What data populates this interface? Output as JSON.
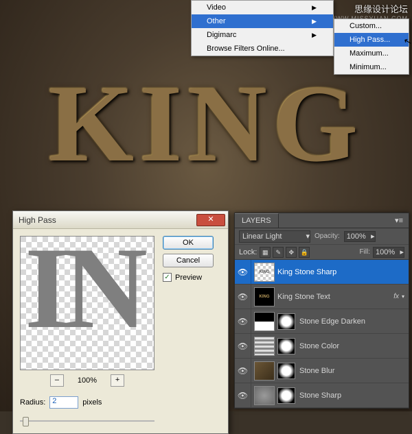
{
  "watermark": {
    "text": "思缘设计论坛",
    "sub": "WWW.MISSYUAN.COM"
  },
  "canvas": {
    "text": "KING"
  },
  "menu1": {
    "items": [
      {
        "label": "Video",
        "arrow": "▶"
      },
      {
        "label": "Other",
        "arrow": "▶",
        "hl": true
      },
      {
        "label": "Digimarc",
        "arrow": "▶"
      },
      {
        "label": "Browse Filters Online...",
        "arrow": ""
      }
    ]
  },
  "menu2": {
    "items": [
      {
        "label": "Custom..."
      },
      {
        "label": "High Pass...",
        "hl": true
      },
      {
        "label": "Maximum..."
      },
      {
        "label": "Minimum..."
      }
    ]
  },
  "dialog": {
    "title": "High Pass",
    "ok": "OK",
    "cancel": "Cancel",
    "preview": "Preview",
    "zoom_minus": "–",
    "zoom_pct": "100%",
    "zoom_plus": "+",
    "radius_label": "Radius:",
    "radius_value": "2",
    "radius_unit": "pixels",
    "preview_text": "IN"
  },
  "layers": {
    "tab": "LAYERS",
    "blend": "Linear Light",
    "opacity_label": "Opacity:",
    "opacity_value": "100%",
    "lock_label": "Lock:",
    "fill_label": "Fill:",
    "fill_value": "100%",
    "items": [
      {
        "name": "King Stone Sharp",
        "sel": true,
        "thumb": "checker"
      },
      {
        "name": "King Stone Text",
        "thumb": "darktxt",
        "fx": true
      },
      {
        "name": "Stone Edge Darken",
        "thumb": "blackwhite",
        "mask": true
      },
      {
        "name": "Stone Color",
        "thumb": "stripes",
        "mask": true
      },
      {
        "name": "Stone Blur",
        "thumb": "stone",
        "mask": true
      },
      {
        "name": "Stone Sharp",
        "thumb": "grain",
        "mask": true
      }
    ]
  }
}
